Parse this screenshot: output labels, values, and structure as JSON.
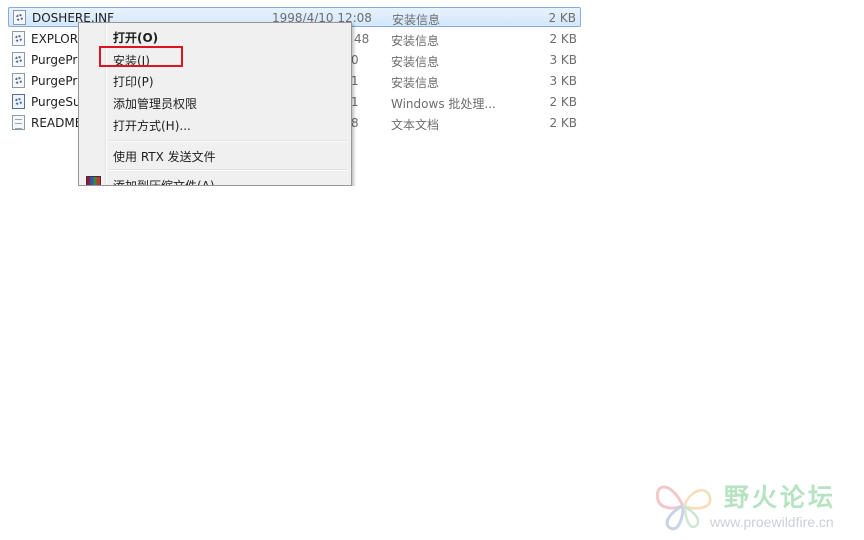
{
  "files": [
    {
      "name": "DOSHERE.INF",
      "date": "1998/4/10 12:08",
      "type": "安装信息",
      "size": "2 KB",
      "icon": "inf-file-icon",
      "selected": true
    },
    {
      "name": "EXPLOR",
      "date": "48",
      "type": "安装信息",
      "size": "2 KB",
      "icon": "inf-file-icon",
      "selected": false
    },
    {
      "name": "PurgePr",
      "date": "0",
      "type": "安装信息",
      "size": "3 KB",
      "icon": "inf-file-icon",
      "selected": false
    },
    {
      "name": "PurgePr",
      "date": "1",
      "type": "安装信息",
      "size": "3 KB",
      "icon": "inf-file-icon",
      "selected": false
    },
    {
      "name": "PurgeSu",
      "date": "1",
      "type": "Windows 批处理...",
      "size": "2 KB",
      "icon": "batch-file-icon",
      "selected": false
    },
    {
      "name": "README",
      "date": "8",
      "type": "文本文档",
      "size": "2 KB",
      "icon": "text-file-icon",
      "selected": false
    }
  ],
  "context_menu": {
    "items": [
      {
        "label": "打开(O)",
        "bold": true
      },
      {
        "label": "安装(I)",
        "highlighted": true
      },
      {
        "label": "打印(P)"
      },
      {
        "label": "添加管理员权限"
      },
      {
        "label": "打开方式(H)..."
      },
      {
        "label": "使用 RTX 发送文件"
      },
      {
        "label": "添加到压缩文件(A)",
        "icon": "winrar-icon"
      }
    ]
  },
  "watermark": {
    "title": "野火论坛",
    "url": "www.proewildfire.cn"
  },
  "colors": {
    "selection_bg": "#d9ebfc",
    "selection_border": "#84acdd",
    "menu_bg": "#f0f0f0",
    "highlight_box": "#e0141e",
    "watermark_green": "#b7e3c2"
  }
}
